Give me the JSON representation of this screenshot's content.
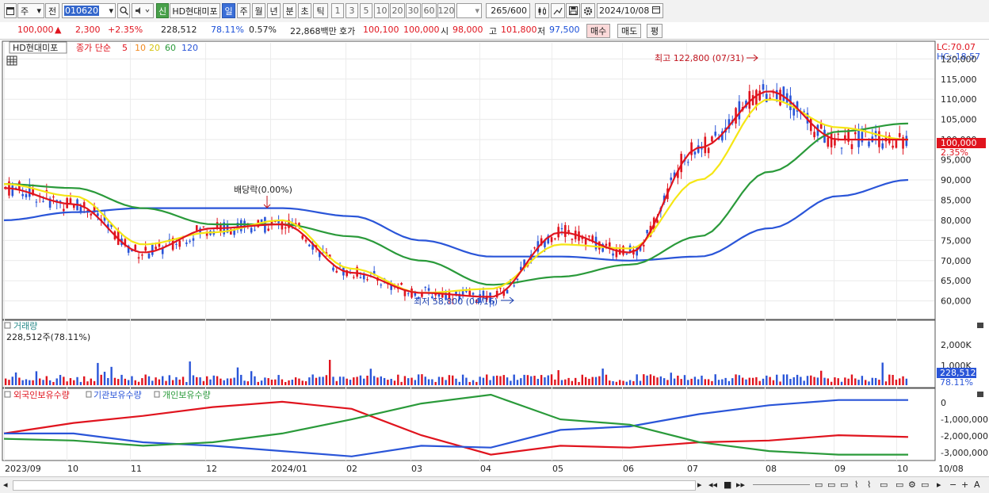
{
  "toolbar": {
    "market": "주",
    "prev_label": "전",
    "stock_code": "010620",
    "badge_new": "신",
    "stock_name": "HD현대미포",
    "periods": [
      "일",
      "주",
      "월",
      "년",
      "분",
      "초",
      "틱"
    ],
    "active_period": "일",
    "minute_steps": [
      "1",
      "3",
      "5",
      "10",
      "20",
      "30",
      "60",
      "120"
    ],
    "count": "265",
    "count_max": "/600",
    "date": "2024/10/08"
  },
  "infobar": {
    "price": "100,000",
    "arrow": "▲",
    "change": "2,300",
    "change_pct": "+2.35%",
    "volume": "228,512",
    "volume_ratio": "78.11%",
    "turnover": "0.57%",
    "amount": "22,868백만",
    "quote_label": "호가",
    "bid": "100,100",
    "ask": "100,000",
    "open_label": "시",
    "open": "98,000",
    "high_label": "고",
    "high": "101,800",
    "low_label": "저",
    "low": "97,500",
    "buy_label": "매수",
    "sell_label": "매도",
    "eval_label": "평"
  },
  "price_panel": {
    "name_box": "HD현대미포",
    "ma_title": "종가 단순",
    "ma_periods": [
      "5",
      "10",
      "20",
      "60",
      "120"
    ],
    "ma_colors": [
      "#e0141e",
      "#f28a1f",
      "#f5e614",
      "#2a9a3a",
      "#2a55d8"
    ],
    "lc": "LC:70.07",
    "hc": "HC:-18.57",
    "y_ticks": [
      "120,000",
      "115,000",
      "110,000",
      "105,000",
      "100,000",
      "95,000",
      "90,000",
      "85,000",
      "80,000",
      "75,000",
      "70,000",
      "65,000",
      "60,000"
    ],
    "current_price_tag": "100,000",
    "current_change_tag": "2.35%",
    "annot_high": "최고 122,800 (07/31)",
    "annot_low": "최저 58,800 (04/16)",
    "annot_dividend": "배당락(0.00%)"
  },
  "volume_panel": {
    "title": "거래량",
    "value_text": "228,512주(78.11%)",
    "y_ticks": [
      "2,000K",
      "1,000K"
    ],
    "current_tag": "228,512",
    "current_pct": "78.11%"
  },
  "holding_panel": {
    "series": [
      "외국인보유수량",
      "기관보유수량",
      "개인보유수량"
    ],
    "series_colors": [
      "#e0141e",
      "#2a55d8",
      "#2a9a3a"
    ],
    "y_ticks": [
      "0",
      "-1,000,000",
      "-2,000,000",
      "-3,000,000"
    ]
  },
  "x_axis": [
    "2023/09",
    "10",
    "11",
    "12",
    "2024/01",
    "02",
    "03",
    "04",
    "05",
    "06",
    "07",
    "08",
    "09",
    "10",
    "10/08"
  ],
  "chart_data": {
    "type": "line",
    "title": "",
    "price": {
      "x": [
        "2023/09",
        "10",
        "11",
        "12",
        "2024/01",
        "02",
        "03",
        "04",
        "05",
        "06",
        "07",
        "08",
        "09",
        "10"
      ],
      "ma5": [
        88000,
        84000,
        72000,
        78000,
        79000,
        67000,
        62000,
        61000,
        77000,
        72000,
        98000,
        112000,
        100000,
        100000
      ],
      "ma20": [
        89000,
        86000,
        74000,
        77000,
        80000,
        68000,
        62000,
        63000,
        74000,
        73000,
        90000,
        110000,
        103000,
        100000
      ],
      "ma60": [
        89000,
        88000,
        83000,
        79000,
        79000,
        76000,
        70000,
        64000,
        66000,
        69000,
        76000,
        92000,
        102000,
        104000
      ],
      "ma120": [
        80000,
        82000,
        83000,
        83000,
        83000,
        81000,
        75000,
        71000,
        71000,
        70000,
        71000,
        78000,
        86000,
        90000
      ],
      "ylim": [
        56000,
        124000
      ]
    },
    "holdings": {
      "foreign": [
        -1900000,
        -1300000,
        -900000,
        -400000,
        -100000,
        -500000,
        -2000000,
        -3100000,
        -2600000,
        -2700000,
        -2400000,
        -2300000,
        -2000000,
        -2100000
      ],
      "institution": [
        -1900000,
        -1900000,
        -2400000,
        -2600000,
        -2900000,
        -3200000,
        -2600000,
        -2700000,
        -1700000,
        -1500000,
        -800000,
        -300000,
        0,
        0
      ],
      "individual": [
        -2200000,
        -2300000,
        -2600000,
        -2400000,
        -1900000,
        -1100000,
        -200000,
        300000,
        -1100000,
        -1400000,
        -2400000,
        -2900000,
        -3100000,
        -3100000
      ],
      "ylim": [
        -3300000,
        300000
      ]
    }
  }
}
